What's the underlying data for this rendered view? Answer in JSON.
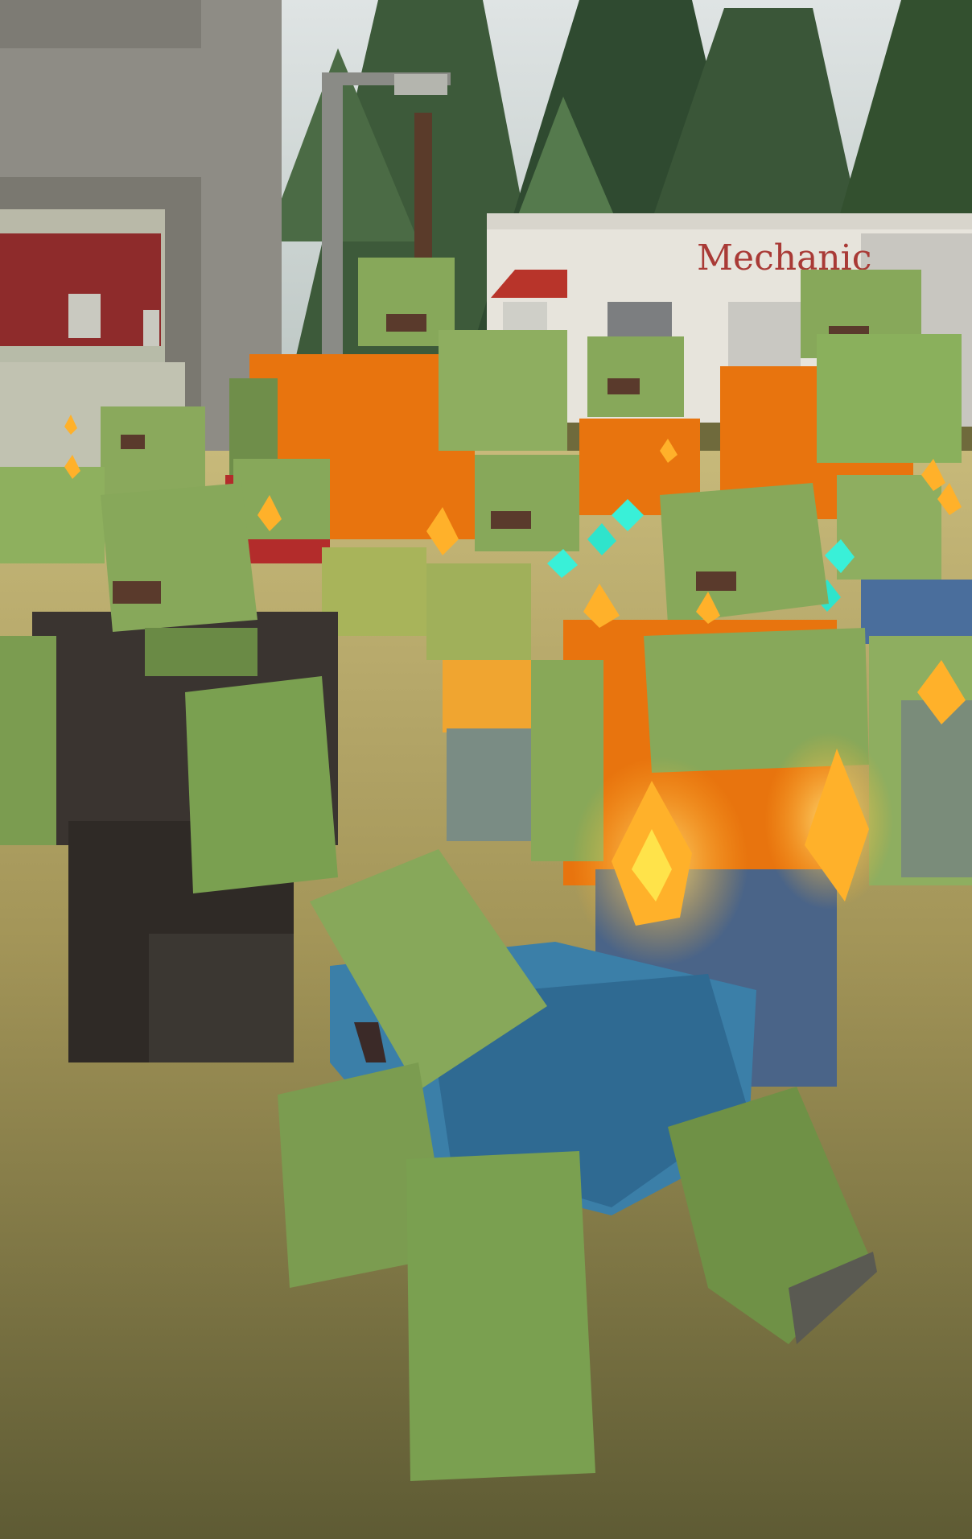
{
  "scene": {
    "sign_text": "Mechanic"
  },
  "colors": {
    "sky": "#cfd6d8",
    "ground_light": "#b8ab6a",
    "ground_dark": "#5d5a33",
    "zombie_skin": "#87a85a",
    "zombie_skin_dark": "#6a8a45",
    "shirt_orange": "#e8740e",
    "shirt_black": "#3a3430",
    "shirt_blue": "#3b7fa8",
    "pants_blue": "#4a6e8c",
    "fire": "#ffb12a",
    "fire_core": "#ffe34a",
    "sparkle": "#39f0d8",
    "building_white": "#e7e4dc",
    "building_grey": "#8c8a82",
    "red_building": "#8e2b2b",
    "tree": "#3e5b3b",
    "sign_red": "#a93a36"
  }
}
